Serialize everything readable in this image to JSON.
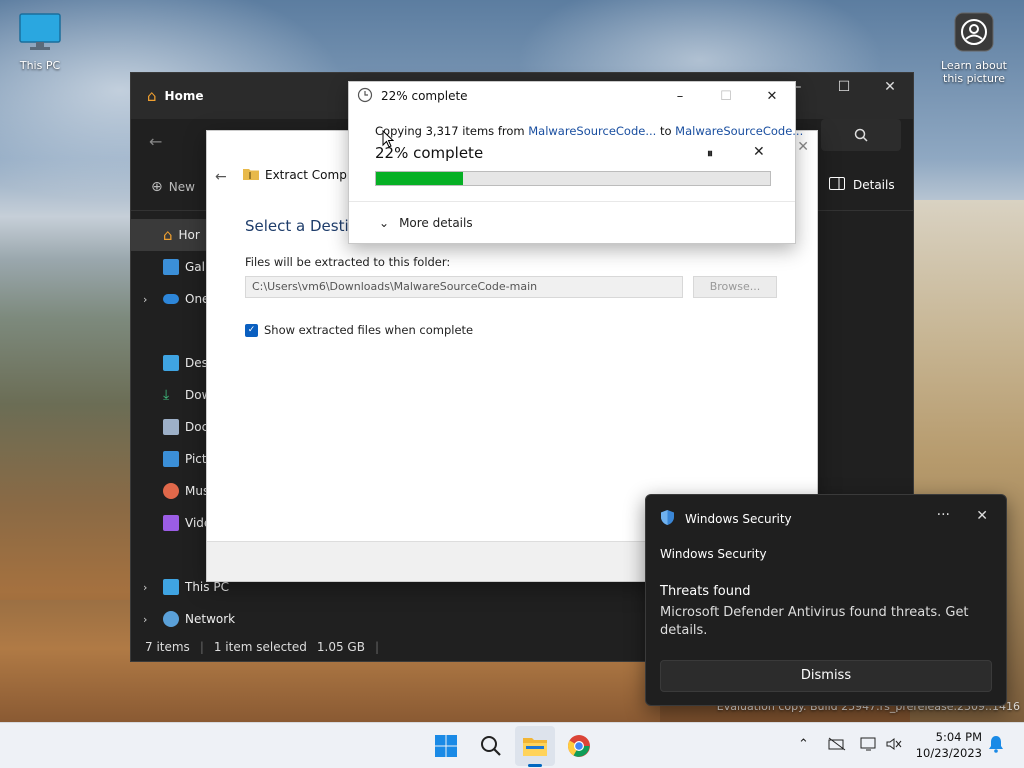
{
  "desktop": {
    "icons": [
      {
        "label": "This PC"
      },
      {
        "label": "Learn about\nthis picture",
        "line1": "Learn about",
        "line2": "this picture"
      }
    ],
    "watermark": "Evaluation copy. Build 25947.rs_prerelease.2309..1416"
  },
  "explorer": {
    "title": "Home",
    "new_label": "New",
    "details_label": "Details",
    "sidebar": [
      {
        "label": "Hor",
        "icon": "home-icon"
      },
      {
        "label": "Gall",
        "icon": "gallery-icon"
      },
      {
        "label": "One",
        "icon": "onedrive-icon"
      },
      {
        "label": "Desl",
        "icon": "desktop-folder-icon"
      },
      {
        "label": "Dow",
        "icon": "downloads-icon"
      },
      {
        "label": "Doc",
        "icon": "documents-icon"
      },
      {
        "label": "Pict",
        "icon": "pictures-icon"
      },
      {
        "label": "Mus",
        "icon": "music-icon"
      },
      {
        "label": "Vide",
        "icon": "videos-icon"
      },
      {
        "label": "This PC",
        "icon": "this-pc-icon"
      },
      {
        "label": "Network",
        "icon": "network-icon"
      }
    ],
    "status": {
      "items": "7 items",
      "selected": "1 item selected",
      "size": "1.05 GB"
    }
  },
  "extract": {
    "header": "Extract Compres",
    "heading": "Select a Destina",
    "folder_label": "Files will be extracted to this folder:",
    "path": "C:\\Users\\vm6\\Downloads\\MalwareSourceCode-main",
    "browse": "Browse...",
    "show_files_label": "Show extracted files when complete"
  },
  "progress": {
    "title": "22% complete",
    "copying_prefix": "Copying 3,317 items from ",
    "source": "MalwareSourceCode...",
    "to": " to ",
    "dest": "MalwareSourceCode...",
    "big": "22% complete",
    "percent": 22,
    "pause_glyph": "⏸",
    "more_details": "More details"
  },
  "toast": {
    "header": "Windows Security",
    "app": "Windows Security",
    "title": "Threats found",
    "body": "Microsoft Defender Antivirus found threats. Get details.",
    "dismiss": "Dismiss"
  },
  "taskbar": {
    "time": "5:04 PM",
    "date": "10/23/2023"
  },
  "colors": {
    "accent": "#0067c0",
    "progress_fill": "#06b025",
    "toast_bg": "#1f1f1f",
    "explorer_bg": "#202020"
  }
}
